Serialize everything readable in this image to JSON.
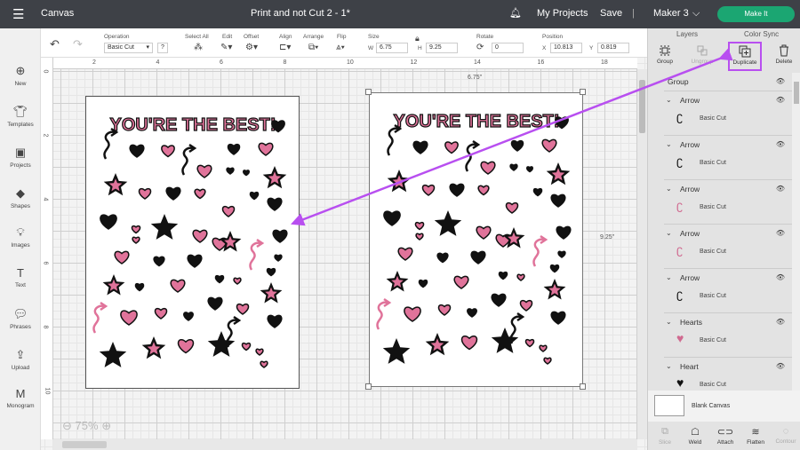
{
  "topbar": {
    "menu_icon": "hamburger-icon",
    "app_title": "Canvas",
    "project_title": "Print and not Cut 2 - 1*",
    "bell_icon": "bell-icon",
    "my_projects": "My Projects",
    "save": "Save",
    "machine": "Maker 3",
    "make_it": "Make It",
    "make_it_color": "#1ba672"
  },
  "sidebar": {
    "items": [
      {
        "label": "New",
        "icon": "plus-circle-icon"
      },
      {
        "label": "Templates",
        "icon": "shirt-icon"
      },
      {
        "label": "Projects",
        "icon": "projects-icon"
      },
      {
        "label": "Shapes",
        "icon": "shapes-icon"
      },
      {
        "label": "Images",
        "icon": "lightbulb-icon"
      },
      {
        "label": "Text",
        "icon": "text-icon"
      },
      {
        "label": "Phrases",
        "icon": "speech-bubble-icon"
      },
      {
        "label": "Upload",
        "icon": "upload-icon"
      },
      {
        "label": "Monogram",
        "icon": "monogram-icon"
      }
    ]
  },
  "toolbar": {
    "operation_label": "Operation",
    "operation_value": "Basic Cut",
    "help": "?",
    "select_all": "Select All",
    "edit": "Edit",
    "offset": "Offset",
    "align": "Align",
    "arrange": "Arrange",
    "flip": "Flip",
    "size_label": "Size",
    "w_label": "W",
    "w_value": "6.75",
    "h_label": "H",
    "h_value": "9.25",
    "rotate_label": "Rotate",
    "rotate_value": "0",
    "position_label": "Position",
    "x_label": "X",
    "x_value": "10.813",
    "y_label": "Y",
    "y_value": "0.819"
  },
  "canvas": {
    "top_ruler": [
      "2",
      "4",
      "6",
      "8",
      "10",
      "12",
      "14",
      "16",
      "18"
    ],
    "left_ruler": [
      "0",
      "2",
      "4",
      "6",
      "8",
      "10"
    ],
    "width_readout": "6.75\"",
    "height_readout": "9.25\"",
    "zoom": "75%",
    "design_title": "YOU'RE THE BEST!",
    "accent_pink": "#e0739a",
    "highlight_color": "#b84ff0"
  },
  "panel": {
    "tabs": [
      "Layers",
      "Color Sync"
    ],
    "actions": [
      "Group",
      "Ungroup",
      "Duplicate",
      "Delete"
    ],
    "layers": [
      {
        "name": "Group",
        "level": 0
      },
      {
        "name": "Arrow",
        "sub": "Basic Cut"
      },
      {
        "name": "Arrow",
        "sub": "Basic Cut"
      },
      {
        "name": "Arrow",
        "sub": "Basic Cut"
      },
      {
        "name": "Arrow",
        "sub": "Basic Cut"
      },
      {
        "name": "Arrow",
        "sub": "Basic Cut"
      },
      {
        "name": "Hearts",
        "sub": "Basic Cut"
      },
      {
        "name": "Heart",
        "sub": "Basic Cut"
      }
    ],
    "blank_canvas": "Blank Canvas",
    "bottom_tools": [
      "Slice",
      "Weld",
      "Attach",
      "Flatten",
      "Contour"
    ]
  }
}
